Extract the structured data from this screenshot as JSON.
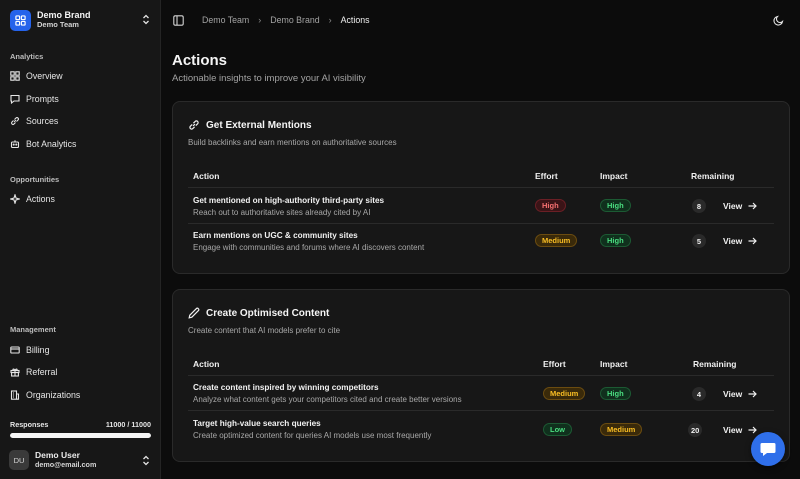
{
  "brand": {
    "name": "Demo Brand",
    "team": "Demo Team"
  },
  "sidebar": {
    "analytics_label": "Analytics",
    "analytics_items": [
      {
        "label": "Overview",
        "icon": "grid-icon"
      },
      {
        "label": "Prompts",
        "icon": "message-icon"
      },
      {
        "label": "Sources",
        "icon": "link-icon"
      },
      {
        "label": "Bot Analytics",
        "icon": "bot-icon"
      }
    ],
    "opportunities_label": "Opportunities",
    "opportunities_items": [
      {
        "label": "Actions",
        "icon": "sparkle-icon"
      }
    ],
    "management_label": "Management",
    "management_items": [
      {
        "label": "Billing",
        "icon": "credit-card-icon"
      },
      {
        "label": "Referral",
        "icon": "gift-icon"
      },
      {
        "label": "Organizations",
        "icon": "building-icon"
      }
    ],
    "usage": {
      "label": "Responses",
      "value_text": "11000 / 11000",
      "fraction": 1.0
    },
    "user": {
      "initials": "DU",
      "name": "Demo User",
      "email": "demo@email.com"
    }
  },
  "breadcrumb": [
    "Demo Team",
    "Demo Brand",
    "Actions"
  ],
  "page": {
    "title": "Actions",
    "subtitle": "Actionable insights to improve your AI visibility"
  },
  "cards": [
    {
      "title": "Get External Mentions",
      "subtitle": "Build backlinks and earn mentions on authoritative sources",
      "headers": {
        "action": "Action",
        "effort": "Effort",
        "impact": "Impact",
        "remaining": "Remaining"
      },
      "rows": [
        {
          "title": "Get mentioned on high-authority third-party sites",
          "desc": "Reach out to authoritative sites already cited by AI",
          "effort": "High",
          "impact": "High",
          "remaining": "8",
          "view": "View"
        },
        {
          "title": "Earn mentions on UGC & community sites",
          "desc": "Engage with communities and forums where AI discovers content",
          "effort": "Medium",
          "impact": "High",
          "remaining": "5",
          "view": "View"
        }
      ]
    },
    {
      "title": "Create Optimised Content",
      "subtitle": "Create content that AI models prefer to cite",
      "headers": {
        "action": "Action",
        "effort": "Effort",
        "impact": "Impact",
        "remaining": "Remaining"
      },
      "rows": [
        {
          "title": "Create content inspired by winning competitors",
          "desc": "Analyze what content gets your competitors cited and create better versions",
          "effort": "Medium",
          "impact": "High",
          "remaining": "4",
          "view": "View"
        },
        {
          "title": "Target high-value search queries",
          "desc": "Create optimized content for queries AI models use most frequently",
          "effort": "Low",
          "impact": "Medium",
          "remaining": "20",
          "view": "View"
        }
      ]
    }
  ],
  "colors": {
    "accent": "#2563eb",
    "high_red": "#f87171",
    "high_green": "#4ade80",
    "medium": "#fbbf24"
  }
}
